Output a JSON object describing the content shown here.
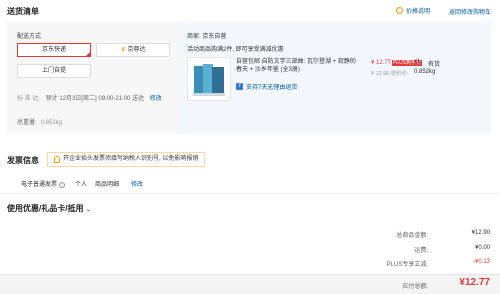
{
  "header": {
    "title": "送货清单",
    "price_note": "价格说明",
    "back_cart": "返回修改购物车"
  },
  "shipping": {
    "method_label": "配送方式",
    "options": {
      "jd_express": "京东快递",
      "jd_zunda": "京尊达",
      "self_pickup": "上门自提"
    },
    "standard_label": "标 准 达:",
    "standard_text": "预计 12月3日[周二] 09:00-21:00 送达",
    "modify": "修改",
    "total_weight_label": "总重量:",
    "total_weight_value": "0.852kg"
  },
  "seller": {
    "label": "商家: 京东自营",
    "promo": "活动商品购满2件, 即可享受满减优惠"
  },
  "product": {
    "name": "自营包邮 自防文学三部曲: 瓦尔登湖 + 寂静的春天 + 沙乡年鉴 (全3册)",
    "return_policy": "支持7天无理由退货",
    "return_icon": "7-day-return-icon",
    "price": "¥ 12.77",
    "plus_tag": "PLUS到手价",
    "plus_original": "¥ 12.90 原价价",
    "qty": "x1",
    "stock": "有货",
    "weight": "0.852kg"
  },
  "invoice": {
    "title": "发票信息",
    "tip": "开企业抬头发票须填写纳税人识别号, 以免影响报销",
    "type": "电子普通发票",
    "person": "个人",
    "detail": "商品明细",
    "modify": "修改"
  },
  "coupon": {
    "title": "使用优惠/礼品卡/抵用"
  },
  "summary": {
    "goods_total_label": "总商品金额:",
    "goods_total_value": "¥12.90",
    "freight_label": "运费:",
    "freight_value": "¥0.00",
    "plus_discount_label": "PLUS专享立减:",
    "plus_discount_value": "-¥0.13",
    "pay_label": "应付总额:",
    "pay_value": "¥12.77"
  },
  "colors": {
    "accent_red": "#e4393c",
    "link_blue": "#005ea7",
    "tip_orange": "#ff9900"
  }
}
